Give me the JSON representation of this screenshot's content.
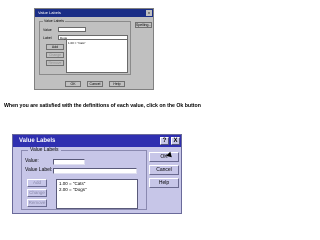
{
  "mini_dialog": {
    "title": "Value Labels",
    "close_glyph": "x",
    "group_label": "Value Labels",
    "value_label": "Value",
    "value_label_label": "Label",
    "value_label_field": "Dogs",
    "spelling_button": "Spelling...",
    "add_button": "Add",
    "change_button": "Change",
    "remove_button": "Remove",
    "list_items": [
      "1.00 = \"Cats\""
    ],
    "ok_button": "OK",
    "cancel_button": "Cancel",
    "help_button": "Help"
  },
  "caption": "When you are satisfied with the definitions of each value, click on the Ok button",
  "dialog": {
    "title": "Value Labels",
    "help_glyph": "?",
    "close_glyph": "X",
    "group_label": "Value Labels",
    "value_label": "Value:",
    "value_label_label": "Value Label:",
    "add_button": "Add",
    "change_button": "Change",
    "remove_button": "Remove",
    "list_items": [
      "1.00 = \"Cats\"",
      "2.00 = \"Dogs\""
    ],
    "ok_button": "OK",
    "cancel_button": "Cancel",
    "help_button": "Help"
  },
  "colors": {
    "title_bar": "#2f2fb0",
    "dialog_face": "#c7c6e8"
  }
}
